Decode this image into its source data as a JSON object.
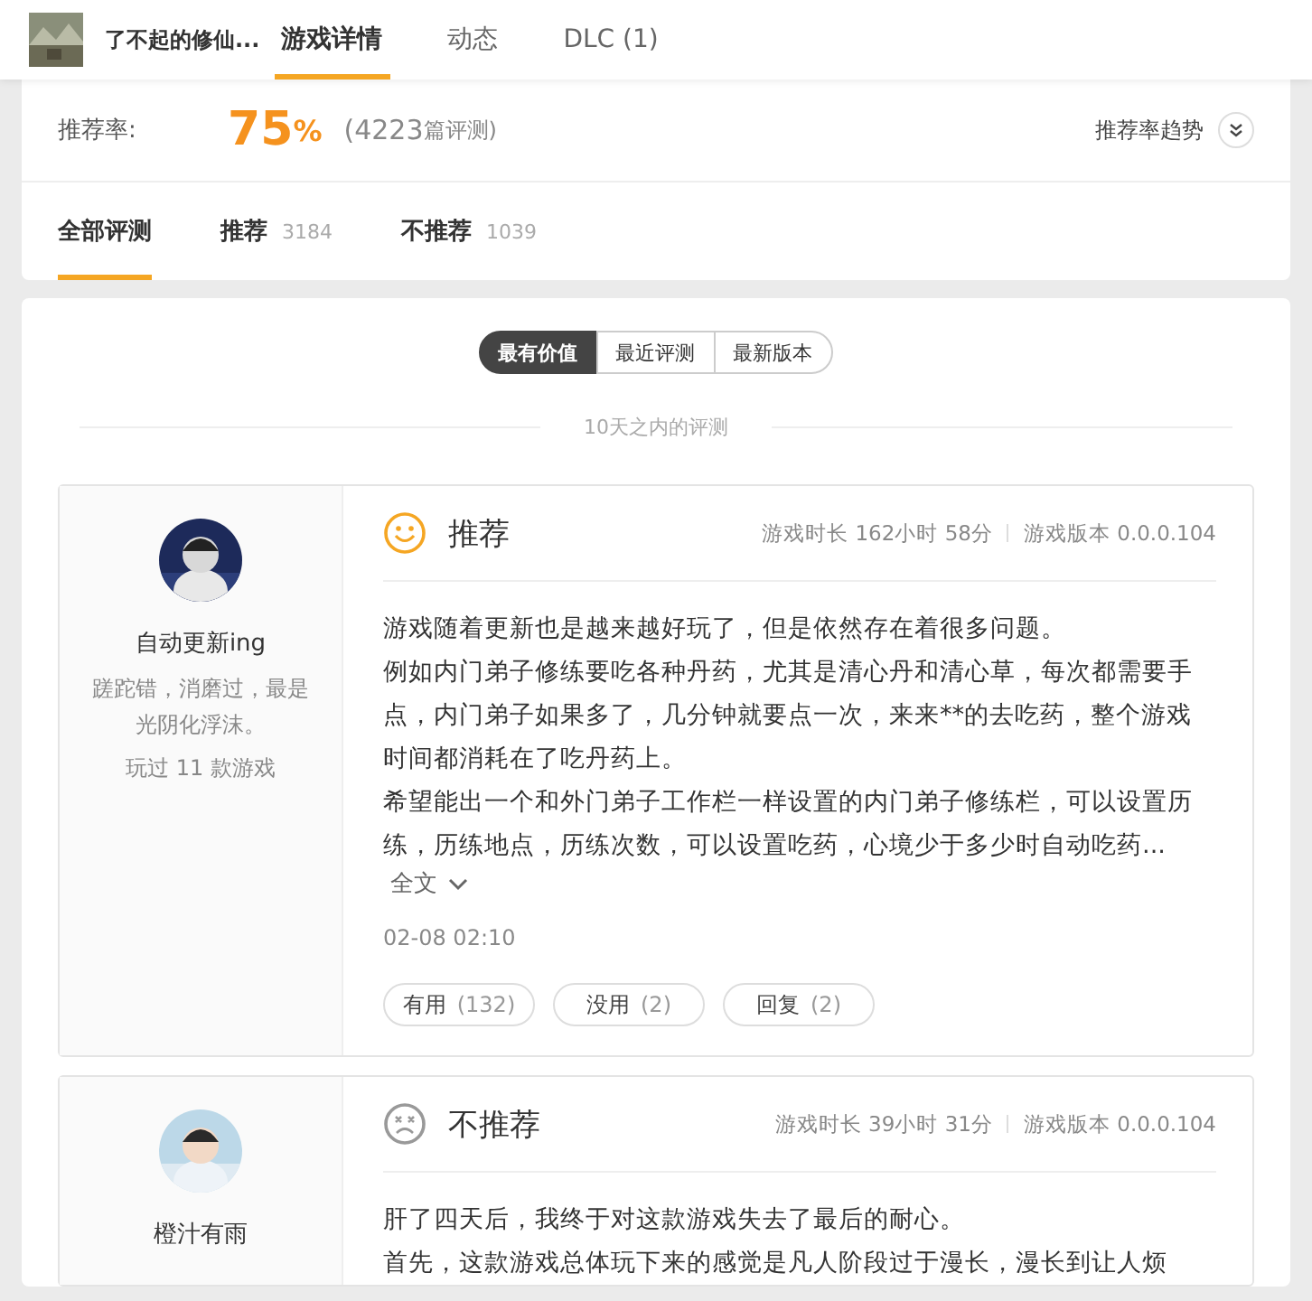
{
  "header": {
    "game_title": "了不起的修仙...",
    "tabs": [
      {
        "label": "游戏详情",
        "selected": true
      },
      {
        "label": "动态",
        "selected": false
      },
      {
        "label": "DLC (1)",
        "selected": false
      }
    ]
  },
  "summary": {
    "label": "推荐率:",
    "rate": "75",
    "percent": "%",
    "count_open": "(4223",
    "count_unit": "篇评测)",
    "trend_label": "推荐率趋势"
  },
  "filter_tabs": [
    {
      "label": "全部评测",
      "selected": true
    },
    {
      "label": "推荐",
      "count": "3184",
      "selected": false
    },
    {
      "label": "不推荐",
      "count": "1039",
      "selected": false
    }
  ],
  "sort_options": [
    {
      "label": "最有价值",
      "selected": true
    },
    {
      "label": "最近评测",
      "selected": false
    },
    {
      "label": "最新版本",
      "selected": false
    }
  ],
  "section_divider": "10天之内的评测",
  "reviews": [
    {
      "user": "自动更新ing",
      "motto": "蹉跎错，消磨过，最是光阴化浮沫。",
      "played": "玩过 11 款游戏",
      "kind": "positive",
      "verdict": "推荐",
      "playtime": "游戏时长 162小时 58分",
      "version": "游戏版本 0.0.0.104",
      "paragraphs": [
        "游戏随着更新也是越来越好玩了，但是依然存在着很多问题。",
        "例如内门弟子修练要吃各种丹药，尤其是清心丹和清心草，每次都需要手点，内门弟子如果多了，几分钟就要点一次，来来**的去吃药，整个游戏时间都消耗在了吃丹药上。",
        "希望能出一个和外门弟子工作栏一样设置的内门弟子修练栏，可以设置历练，历练地点，历练次数，可以设置吃药，心境少于多少时自动吃药..."
      ],
      "expand": "全文",
      "date": "02-08 02:10",
      "actions": [
        {
          "label": "有用",
          "count": "(132)"
        },
        {
          "label": "没用",
          "count": "(2)"
        },
        {
          "label": "回复",
          "count": "(2)"
        }
      ]
    },
    {
      "user": "橙汁有雨",
      "kind": "negative",
      "verdict": "不推荐",
      "playtime": "游戏时长 39小时 31分",
      "version": "游戏版本 0.0.0.104",
      "paragraphs": [
        "肝了四天后，我终于对这款游戏失去了最后的耐心。",
        "首先，这款游戏总体玩下来的感觉是凡人阶段过于漫长，漫长到让人烦"
      ]
    }
  ]
}
